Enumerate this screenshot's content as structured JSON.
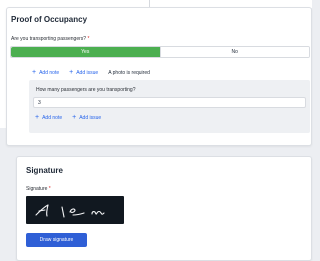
{
  "occupancy": {
    "title": "Proof of Occupancy",
    "question": "Are you transporting passengers?",
    "required_mark": "*",
    "options": {
      "yes": "Yes",
      "no": "No"
    },
    "selected": "Yes",
    "add_note": "Add note",
    "add_issue": "Add issue",
    "photo_required": "A photo is required",
    "passengers": {
      "question": "How many passengers are you transporting?",
      "value": "3",
      "add_note": "Add note",
      "add_issue": "Add issue"
    }
  },
  "signature": {
    "title": "Signature",
    "label": "Signature",
    "required_mark": "*",
    "draw_button": "Draw signature"
  },
  "colors": {
    "accent_green": "#4caf50",
    "link_blue": "#2563eb",
    "button_blue": "#2f5fd6",
    "required_red": "#dc2626"
  }
}
